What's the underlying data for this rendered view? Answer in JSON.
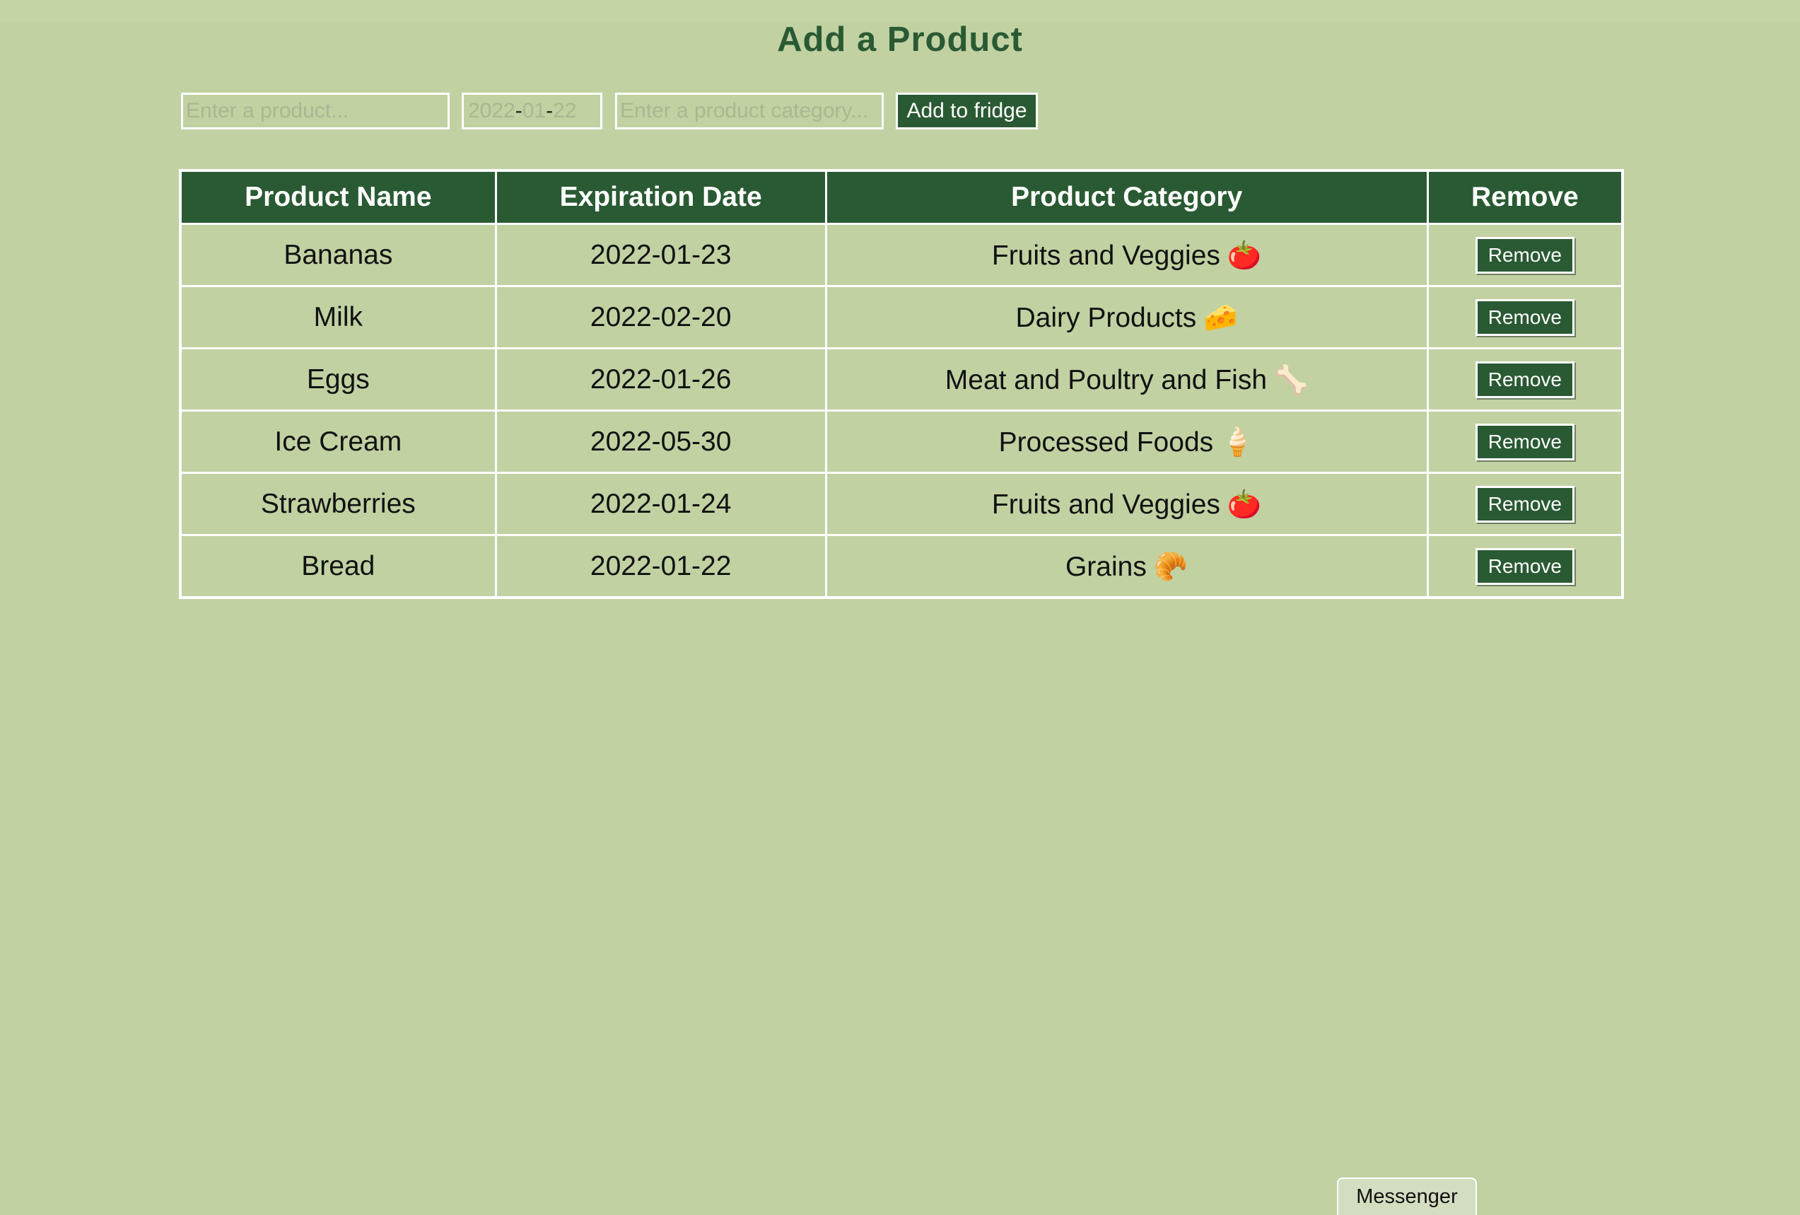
{
  "page": {
    "title": "Add a Product"
  },
  "form": {
    "product_placeholder": "Enter a product...",
    "date": {
      "year": "2022",
      "month": "01",
      "day": "22",
      "separator": "-"
    },
    "category_placeholder": "Enter a product category...",
    "add_button_label": "Add to fridge"
  },
  "table": {
    "headers": [
      "Product Name",
      "Expiration Date",
      "Product Category",
      "Remove"
    ],
    "rows": [
      {
        "name": "Bananas",
        "date": "2022-01-23",
        "category": "Fruits and Veggies",
        "emoji": "🍅",
        "remove_label": "Remove"
      },
      {
        "name": "Milk",
        "date": "2022-02-20",
        "category": "Dairy Products",
        "emoji": "🧀",
        "remove_label": "Remove"
      },
      {
        "name": "Eggs",
        "date": "2022-01-26",
        "category": "Meat and Poultry and Fish",
        "emoji": "🦴",
        "remove_label": "Remove"
      },
      {
        "name": "Ice Cream",
        "date": "2022-05-30",
        "category": "Processed Foods",
        "emoji": "🍦",
        "remove_label": "Remove"
      },
      {
        "name": "Strawberries",
        "date": "2022-01-24",
        "category": "Fruits and Veggies",
        "emoji": "🍅",
        "remove_label": "Remove"
      },
      {
        "name": "Bread",
        "date": "2022-01-22",
        "category": "Grains",
        "emoji": "🥐",
        "remove_label": "Remove"
      }
    ]
  },
  "messenger": {
    "label": "Messenger"
  },
  "colors": {
    "background": "#c1d1a2",
    "accent": "#2a5a33",
    "border": "#ffffff"
  }
}
